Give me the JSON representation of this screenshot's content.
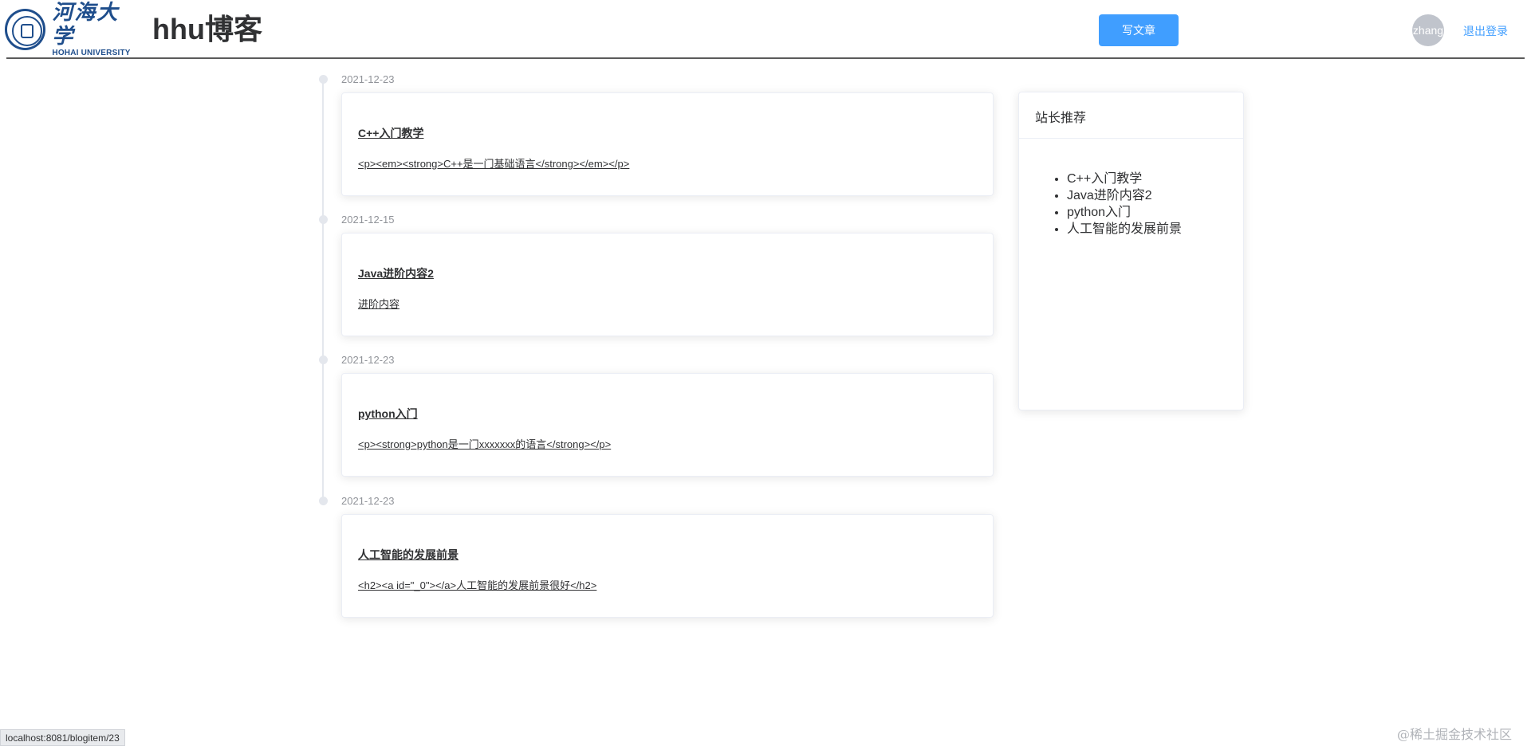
{
  "header": {
    "logo_cn": "河海大学",
    "logo_en": "HOHAI UNIVERSITY",
    "site_title": "hhu博客",
    "write_button": "写文章",
    "avatar_text": "zhang",
    "logout": "退出登录"
  },
  "timeline": [
    {
      "date": "2021-12-23",
      "title": "C++入门教学",
      "body": "<p><em><strong>C++是一门基础语言</strong></em></p>"
    },
    {
      "date": "2021-12-15",
      "title": "Java进阶内容2",
      "body": "进阶内容"
    },
    {
      "date": "2021-12-23",
      "title": "python入门",
      "body": "<p><strong>python是一门xxxxxxx的语言</strong></p>"
    },
    {
      "date": "2021-12-23",
      "title": "人工智能的发展前景",
      "body": "<h2><a id=\"_0\"></a>人工智能的发展前景很好</h2>"
    }
  ],
  "recommend": {
    "title": "站长推荐",
    "items": [
      "C++入门教学",
      "Java进阶内容2",
      "python入门",
      "人工智能的发展前景"
    ]
  },
  "status_bar": "localhost:8081/blogitem/23",
  "watermark": "@稀土掘金技术社区",
  "colors": {
    "primary": "#409eff",
    "border": "#ebeef5",
    "date": "#909399"
  }
}
